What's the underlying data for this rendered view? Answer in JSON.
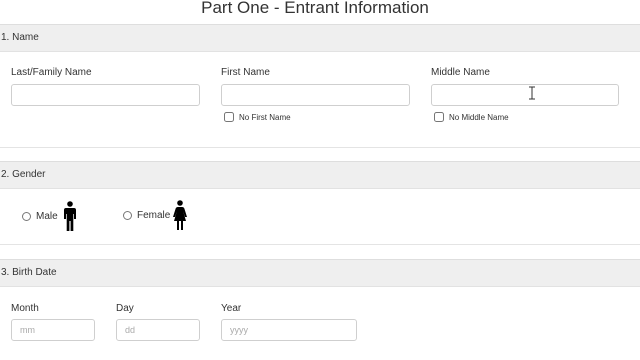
{
  "page": {
    "title": "Part One - Entrant Information"
  },
  "sections": {
    "name": {
      "header": "1. Name",
      "last_name_label": "Last/Family Name",
      "first_name_label": "First Name",
      "middle_name_label": "Middle Name",
      "last_name_value": "",
      "first_name_value": "",
      "middle_name_value": "",
      "no_first_name_label": "No First Name",
      "no_middle_name_label": "No Middle Name"
    },
    "gender": {
      "header": "2. Gender",
      "male_label": "Male",
      "female_label": "Female",
      "male_icon": "male-figure-icon",
      "female_icon": "female-figure-icon"
    },
    "birth_date": {
      "header": "3. Birth Date",
      "month_label": "Month",
      "day_label": "Day",
      "year_label": "Year",
      "month_placeholder": "mm",
      "day_placeholder": "dd",
      "year_placeholder": "yyyy"
    }
  },
  "colors": {
    "section_header_bg": "#efefef",
    "input_border": "#cfcfcf",
    "text": "#333333",
    "placeholder": "#aaaaaa"
  }
}
